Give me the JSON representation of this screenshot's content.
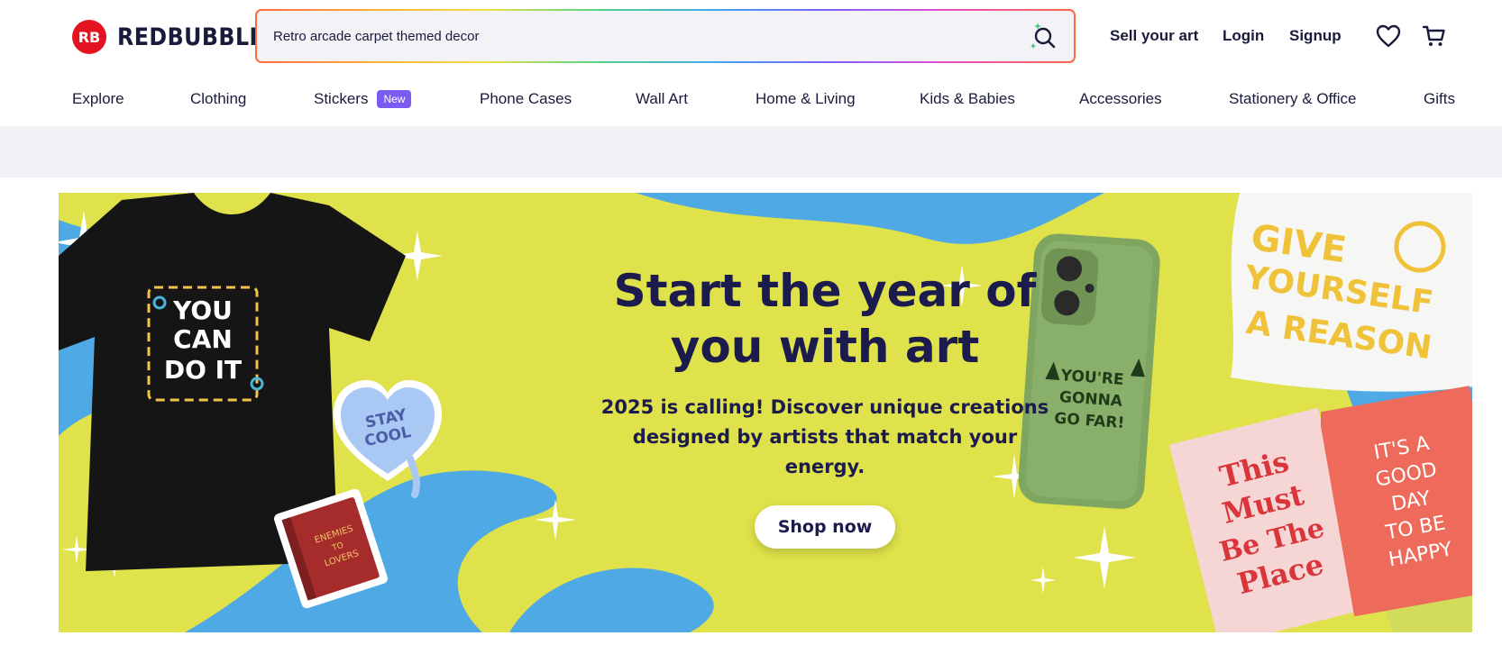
{
  "header": {
    "logo_mark": "RB",
    "logo_text": "REDBUBBLE",
    "search": {
      "value": "Retro arcade carpet themed decor"
    },
    "links": {
      "sell": "Sell your art",
      "login": "Login",
      "signup": "Signup"
    }
  },
  "nav": {
    "items": [
      {
        "label": "Explore"
      },
      {
        "label": "Clothing"
      },
      {
        "label": "Stickers",
        "badge": "New"
      },
      {
        "label": "Phone Cases"
      },
      {
        "label": "Wall Art"
      },
      {
        "label": "Home & Living"
      },
      {
        "label": "Kids & Babies"
      },
      {
        "label": "Accessories"
      },
      {
        "label": "Stationery & Office"
      },
      {
        "label": "Gifts"
      }
    ]
  },
  "hero": {
    "title_line1": "Start the year of",
    "title_line2": "you with art",
    "subtitle": "2025 is calling! Discover unique creations designed by artists that match your energy.",
    "cta": "Shop now",
    "products": {
      "tshirt_text": [
        "YOU",
        "CAN",
        "DO IT"
      ],
      "sticker_text": [
        "STAY",
        "COOL"
      ],
      "book_text": [
        "ENEMIES",
        "TO",
        "LOVERS"
      ],
      "phone_text": [
        "YOU'RE",
        "GONNA",
        "GO FAR!"
      ],
      "pillow_text": [
        "GIVE",
        "YOURSELF",
        "A REASON"
      ],
      "card_pink_text": [
        "This",
        "Must",
        "Be The",
        "Place"
      ],
      "card_red_text": [
        "IT'S A",
        "GOOD",
        "DAY",
        "TO BE",
        "HAPPY"
      ]
    },
    "colors": {
      "yellow": "#dfe24a",
      "blue": "#4fa9e4",
      "navy": "#1c1b4d"
    }
  },
  "icons": {
    "search": "search-sparkle-icon",
    "wishlist": "heart-icon",
    "cart": "cart-icon"
  }
}
